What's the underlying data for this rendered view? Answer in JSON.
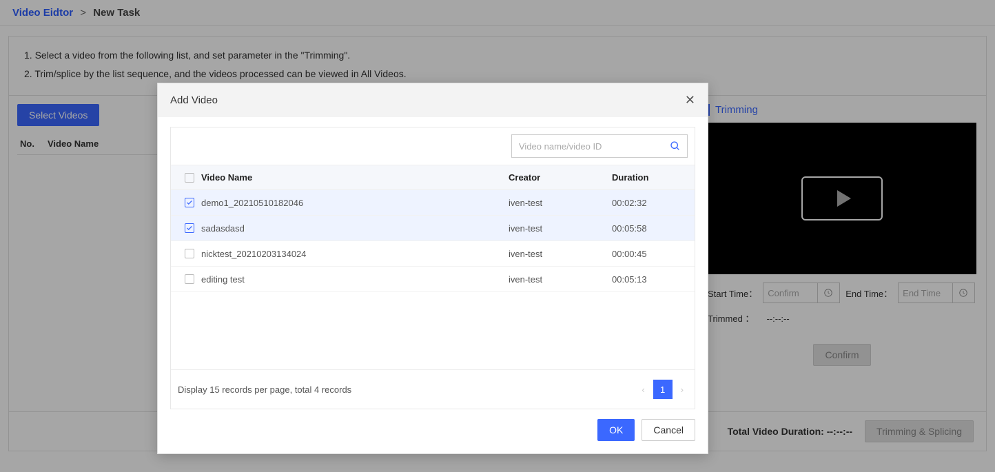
{
  "breadcrumb": {
    "parent": "Video Eidtor",
    "current": "New Task"
  },
  "instructions": {
    "line1": "1. Select a video from the following list, and set parameter in the \"Trimming\".",
    "line2": "2. Trim/splice by the list sequence, and the videos processed can be viewed in All Videos."
  },
  "left": {
    "select_btn": "Select Videos",
    "col_no": "No.",
    "col_name": "Video Name"
  },
  "trimming": {
    "title": "Trimming",
    "start_label": "Start Time：",
    "start_placeholder": "Confirm",
    "end_label": "End Time：",
    "end_placeholder": "End Time",
    "trimmed_label": "Trimmed ：",
    "trimmed_value": "--:--:--",
    "confirm_btn": "Confirm"
  },
  "footer": {
    "total_label": "Total Video Duration:",
    "total_value": "--:--:--",
    "action_btn": "Trimming & Splicing"
  },
  "modal": {
    "title": "Add Video",
    "search_placeholder": "Video name/video ID",
    "columns": {
      "name": "Video Name",
      "creator": "Creator",
      "duration": "Duration"
    },
    "rows": [
      {
        "checked": true,
        "name": "demo1_20210510182046",
        "creator": "iven-test",
        "duration": "00:02:32"
      },
      {
        "checked": true,
        "name": "sadasdasd",
        "creator": "iven-test",
        "duration": "00:05:58"
      },
      {
        "checked": false,
        "name": "nicktest_20210203134024",
        "creator": "iven-test",
        "duration": "00:00:45"
      },
      {
        "checked": false,
        "name": "editing test",
        "creator": "iven-test",
        "duration": "00:05:13"
      }
    ],
    "pager_text": "Display 15 records per page, total 4 records",
    "page_current": "1",
    "ok_btn": "OK",
    "cancel_btn": "Cancel"
  }
}
